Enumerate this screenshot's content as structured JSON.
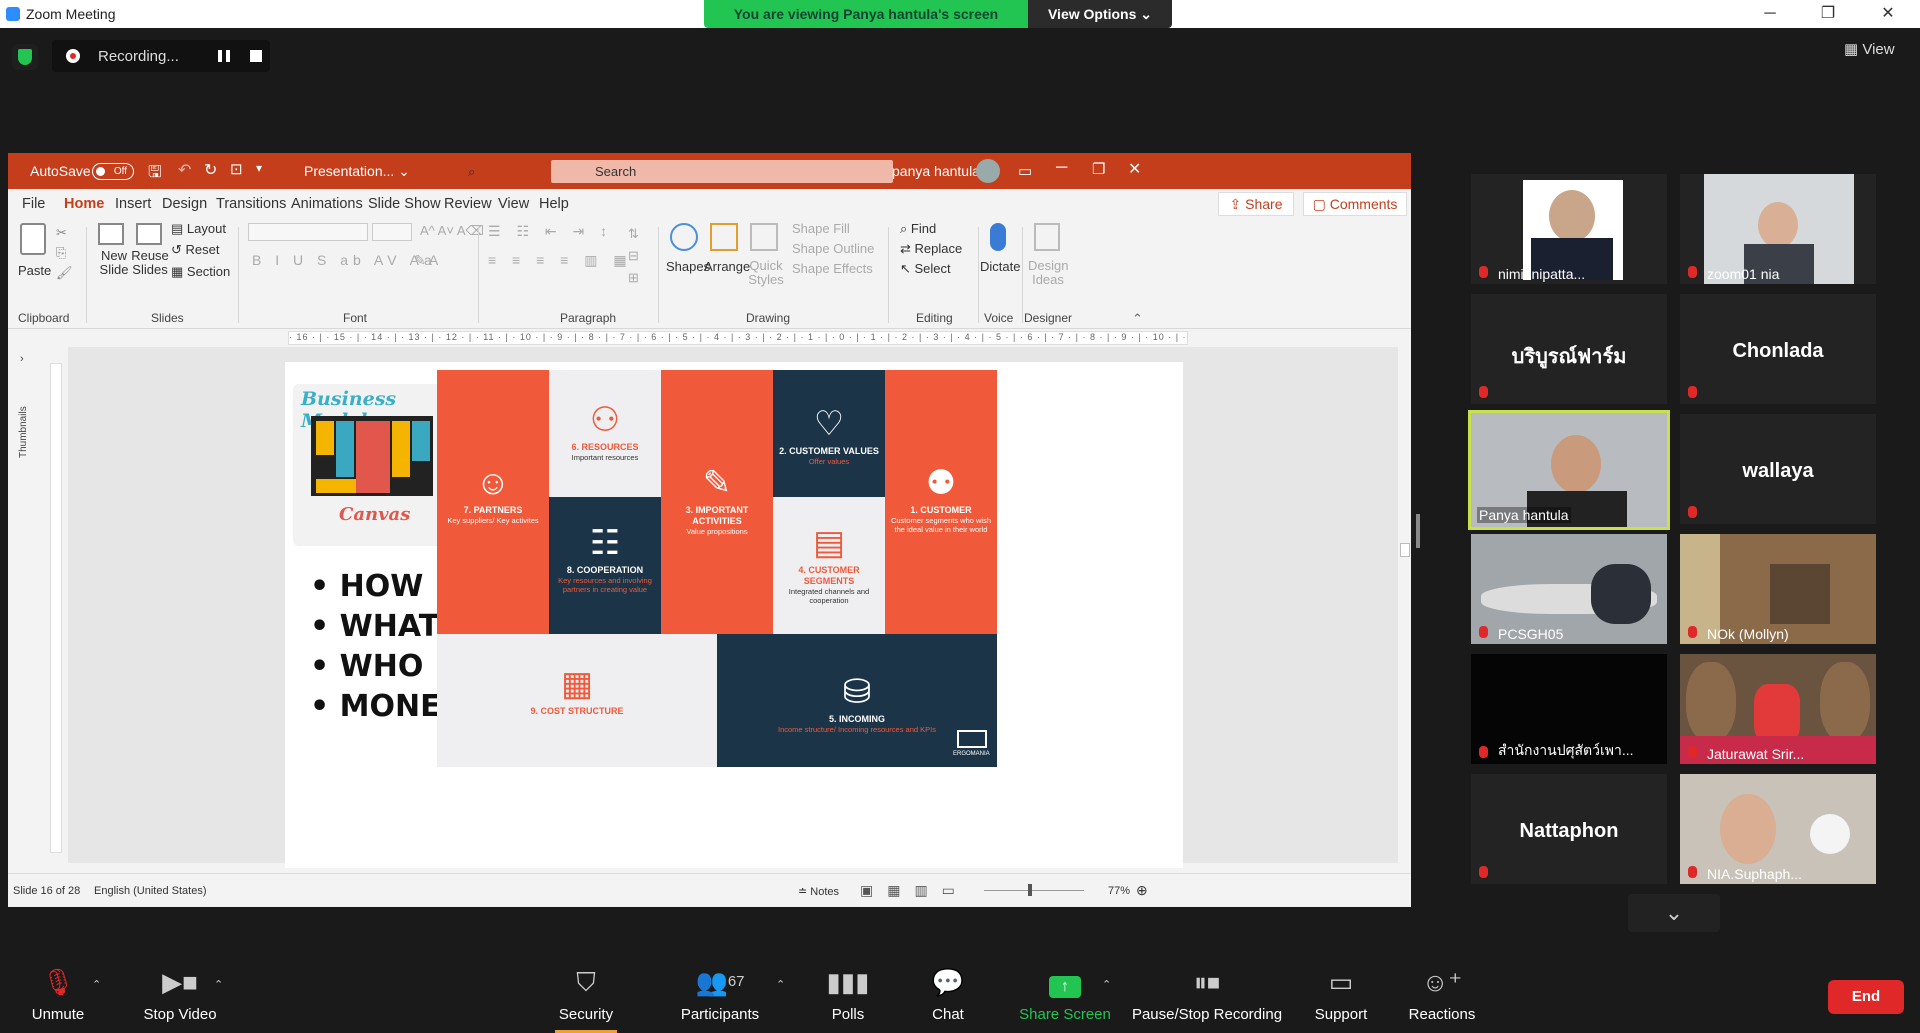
{
  "titlebar": {
    "app_title": "Zoom Meeting",
    "viewing_banner": "You are viewing Panya hantula's screen",
    "view_options": "View Options ⌄"
  },
  "recording": {
    "status": "Recording..."
  },
  "view_button": "View",
  "ppt": {
    "autosave_label": "AutoSave",
    "autosave_state": "Off",
    "doc_title": "Presentation...  ⌄",
    "search_placeholder": "Search",
    "user": "panya hantula",
    "tabs": [
      "File",
      "Home",
      "Insert",
      "Design",
      "Transitions",
      "Animations",
      "Slide Show",
      "Review",
      "View",
      "Help"
    ],
    "share": "Share",
    "comments": "Comments",
    "ribbon": {
      "paste": "Paste",
      "new_slide": "New Slide",
      "reuse_slides": "Reuse Slides",
      "layout": "Layout",
      "reset": "Reset",
      "section": "Section",
      "shapes": "Shapes",
      "arrange": "Arrange",
      "quick_styles": "Quick Styles",
      "shape_fill": "Shape Fill",
      "shape_outline": "Shape Outline",
      "shape_effects": "Shape Effects",
      "find": "Find",
      "replace": "Replace",
      "select": "Select",
      "dictate": "Dictate",
      "design_ideas": "Design Ideas",
      "groups": [
        "Clipboard",
        "Slides",
        "Font",
        "Paragraph",
        "Drawing",
        "Editing",
        "Voice",
        "Designer"
      ]
    },
    "ruler": "· 16 · | · 15 · | · 14 · | · 13 · | · 12 · | · 11 · | · 10 · | · 9 · | · 8 · | · 7 · | · 6 · | · 5 · | · 4 · | · 3 · | · 2 · | · 1 · | · 0 · | · 1 · | · 2 · | · 3 · | · 4 · | · 5 · | · 6 · | · 7 · | · 8 · | · 9 · | · 10 · | · 11 · | · 12 · | · 13 · | · 14 · | · 15 · | · 16 ·",
    "thumbnails_label": "Thumbnails",
    "status": {
      "slide": "Slide 16 of 28",
      "language": "English (United States)",
      "notes": "Notes",
      "zoom": "77%"
    }
  },
  "slide": {
    "logo_top": "Business Model",
    "logo_bottom": "Canvas",
    "bullets": [
      "HOW",
      "WHAT",
      "WHO",
      "MONEY"
    ],
    "cells": {
      "partners": {
        "title": "7. PARTNERS",
        "sub": "Key suppliers/ Key activites"
      },
      "resources": {
        "title": "6. RESOURCES",
        "sub": "Important resources"
      },
      "activities": {
        "title": "3. IMPORTANT ACTIVITIES",
        "sub": "Value propositions"
      },
      "values": {
        "title": "2. CUSTOMER VALUES",
        "sub": "Offer values"
      },
      "customer": {
        "title": "1. CUSTOMER",
        "sub": "Customer segments who wish the ideal value in their world"
      },
      "cooperation": {
        "title": "8. COOPERATION",
        "sub": "Key resources and involving partners in creating value"
      },
      "segments": {
        "title": "4. CUSTOMER SEGMENTS",
        "sub": "Integrated channels and cooperation"
      },
      "cost": {
        "title": "9. COST STRUCTURE"
      },
      "incoming": {
        "title": "5. INCOMING",
        "sub": "Income structure/ Incoming resources and KPIs"
      },
      "brand": "ERGOMANIA"
    }
  },
  "participants": [
    {
      "name": "nimit nipatta..."
    },
    {
      "name": "zoom01 nia"
    },
    {
      "big": "บริบูรณ์ฟาร์ม"
    },
    {
      "big": "Chonlada"
    },
    {
      "name": "Panya hantula"
    },
    {
      "big": "wallaya"
    },
    {
      "name": "PCSGH05"
    },
    {
      "name": "NOk (Mollyn)"
    },
    {
      "name": "สำนักงานปศุสัตว์เพา..."
    },
    {
      "name": "Jaturawat Srir..."
    },
    {
      "big": "Nattaphon"
    },
    {
      "name": "NIA.Suphaph..."
    }
  ],
  "toolbar": {
    "unmute": "Unmute",
    "stop_video": "Stop Video",
    "security": "Security",
    "participants": "Participants",
    "participant_count": "67",
    "polls": "Polls",
    "chat": "Chat",
    "share_screen": "Share Screen",
    "pause_recording": "Pause/Stop Recording",
    "support": "Support",
    "reactions": "Reactions",
    "end": "End"
  },
  "colors": {
    "zoom_green": "#23c552",
    "ppt_red": "#c43e1c",
    "slide_orange": "#f05a3a",
    "slide_navy": "#1c3448",
    "end_red": "#e02828"
  }
}
